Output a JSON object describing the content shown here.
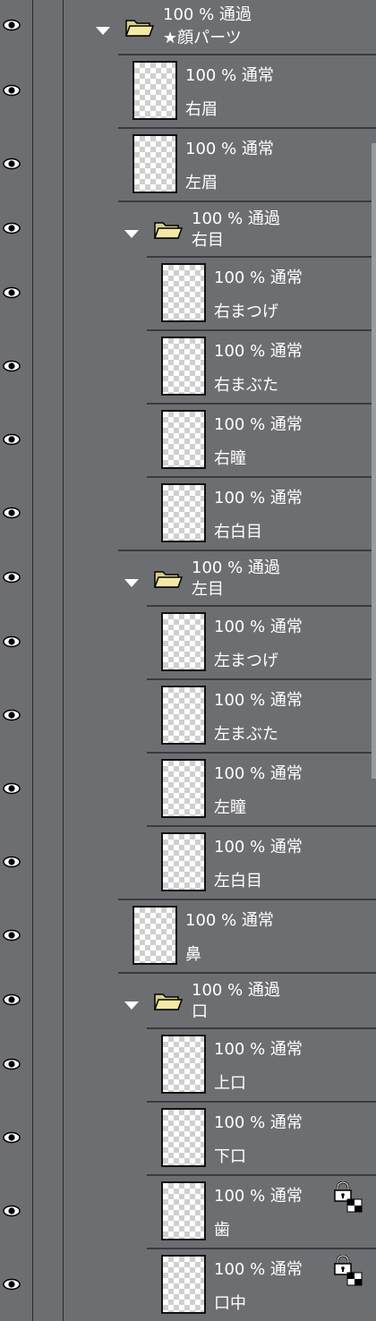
{
  "colors": {
    "panel_bg": "#6d6e72",
    "divider": "#3a3b3e",
    "text": "#ffffff",
    "folder": "#f3e9a6"
  },
  "icons": {
    "visibility": "eye-icon",
    "expand": "triangle-down-icon",
    "folder": "folder-open-icon",
    "lock": "lock-icon"
  },
  "layers": [
    {
      "kind": "folder",
      "opacity": "100 %",
      "blend": "通過",
      "name": "★顔パーツ"
    },
    {
      "kind": "layer",
      "opacity": "100 %",
      "blend": "通常",
      "name": "右眉"
    },
    {
      "kind": "layer",
      "opacity": "100 %",
      "blend": "通常",
      "name": "左眉"
    },
    {
      "kind": "folder",
      "opacity": "100 %",
      "blend": "通過",
      "name": "右目"
    },
    {
      "kind": "layer",
      "opacity": "100 %",
      "blend": "通常",
      "name": "右まつげ"
    },
    {
      "kind": "layer",
      "opacity": "100 %",
      "blend": "通常",
      "name": "右まぶた"
    },
    {
      "kind": "layer",
      "opacity": "100 %",
      "blend": "通常",
      "name": "右瞳"
    },
    {
      "kind": "layer",
      "opacity": "100 %",
      "blend": "通常",
      "name": "右白目"
    },
    {
      "kind": "folder",
      "opacity": "100 %",
      "blend": "通過",
      "name": "左目"
    },
    {
      "kind": "layer",
      "opacity": "100 %",
      "blend": "通常",
      "name": "左まつげ"
    },
    {
      "kind": "layer",
      "opacity": "100 %",
      "blend": "通常",
      "name": "左まぶた"
    },
    {
      "kind": "layer",
      "opacity": "100 %",
      "blend": "通常",
      "name": "左瞳"
    },
    {
      "kind": "layer",
      "opacity": "100 %",
      "blend": "通常",
      "name": "左白目"
    },
    {
      "kind": "layer",
      "opacity": "100 %",
      "blend": "通常",
      "name": "鼻"
    },
    {
      "kind": "folder",
      "opacity": "100 %",
      "blend": "通過",
      "name": "口"
    },
    {
      "kind": "layer",
      "opacity": "100 %",
      "blend": "通常",
      "name": "上口"
    },
    {
      "kind": "layer",
      "opacity": "100 %",
      "blend": "通常",
      "name": "下口"
    },
    {
      "kind": "layer",
      "opacity": "100 %",
      "blend": "通常",
      "name": "歯",
      "locked": true
    },
    {
      "kind": "layer",
      "opacity": "100 %",
      "blend": "通常",
      "name": "口中",
      "locked": true
    }
  ]
}
